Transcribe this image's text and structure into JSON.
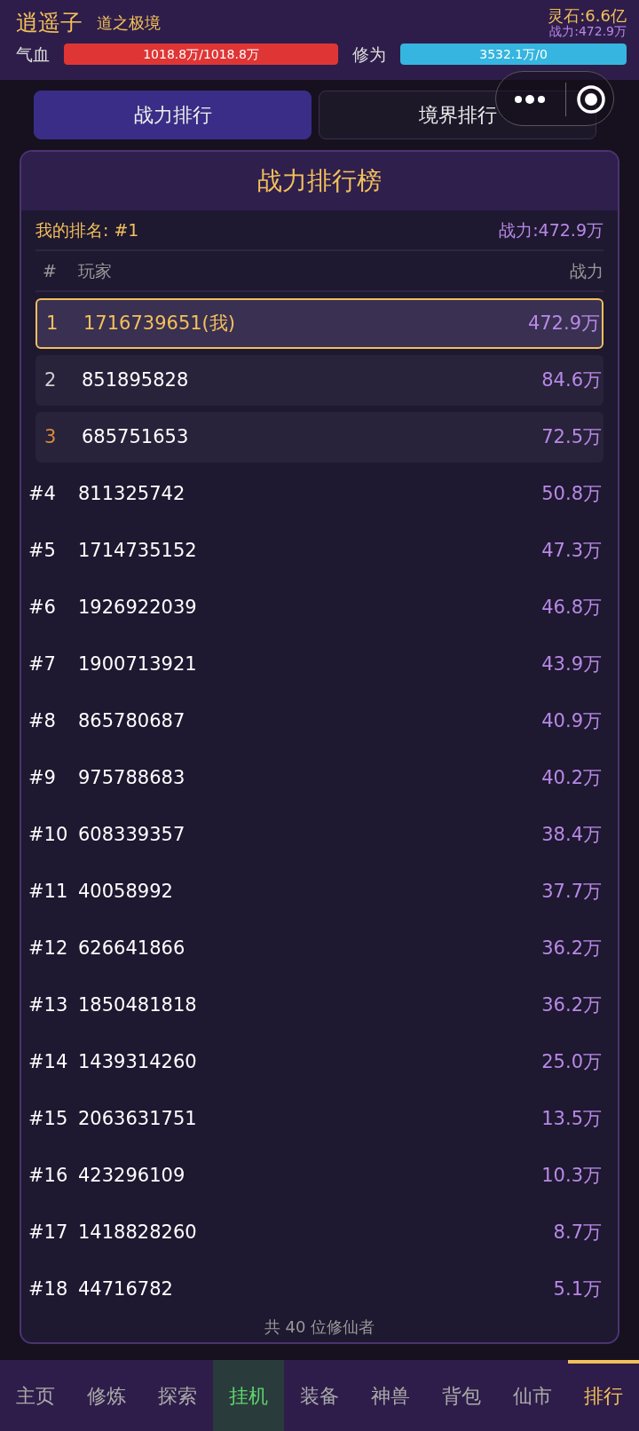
{
  "header": {
    "name": "逍遥子",
    "realm": "道之极境",
    "spirit_stones": "灵石:6.6亿",
    "power": "战力:472.9万",
    "bars": [
      {
        "label": "气血",
        "reading": "1018.8万/1018.8万",
        "level": 1.0,
        "kind": "hp"
      },
      {
        "label": "修为",
        "reading": "3532.1万/0",
        "level": 1.0,
        "kind": "xp"
      }
    ]
  },
  "tabs": [
    {
      "label": "战力排行",
      "selected": true
    },
    {
      "label": "境界排行",
      "selected": false
    }
  ],
  "ranking": {
    "title": "战力排行榜",
    "my_rank": "我的排名: #1",
    "my_power": "战力:472.9万",
    "columns": [
      "#",
      "玩家",
      "战力"
    ],
    "rows": [
      {
        "rank": "1",
        "player": "1716739651(我)",
        "power": "472.9万",
        "kind": "podium",
        "color": "#f3c05a",
        "selected": true
      },
      {
        "rank": "2",
        "player": "851895828",
        "power": "84.6万",
        "kind": "podium",
        "color": "#cfcfcf",
        "selected": false
      },
      {
        "rank": "3",
        "player": "685751653",
        "power": "72.5万",
        "kind": "podium",
        "color": "#d98a3d",
        "selected": false
      },
      {
        "rank": "#4",
        "player": "811325742",
        "power": "50.8万",
        "kind": "plain",
        "selected": false
      },
      {
        "rank": "#5",
        "player": "1714735152",
        "power": "47.3万",
        "kind": "plain",
        "selected": false
      },
      {
        "rank": "#6",
        "player": "1926922039",
        "power": "46.8万",
        "kind": "plain",
        "selected": false
      },
      {
        "rank": "#7",
        "player": "1900713921",
        "power": "43.9万",
        "kind": "plain",
        "selected": false
      },
      {
        "rank": "#8",
        "player": "865780687",
        "power": "40.9万",
        "kind": "plain",
        "selected": false
      },
      {
        "rank": "#9",
        "player": "975788683",
        "power": "40.2万",
        "kind": "plain",
        "selected": false
      },
      {
        "rank": "#10",
        "player": "608339357",
        "power": "38.4万",
        "kind": "plain",
        "selected": false
      },
      {
        "rank": "#11",
        "player": "40058992",
        "power": "37.7万",
        "kind": "plain",
        "selected": false
      },
      {
        "rank": "#12",
        "player": "626641866",
        "power": "36.2万",
        "kind": "plain",
        "selected": false
      },
      {
        "rank": "#13",
        "player": "1850481818",
        "power": "36.2万",
        "kind": "plain",
        "selected": false
      },
      {
        "rank": "#14",
        "player": "1439314260",
        "power": "25.0万",
        "kind": "plain",
        "selected": false
      },
      {
        "rank": "#15",
        "player": "2063631751",
        "power": "13.5万",
        "kind": "plain",
        "selected": false
      },
      {
        "rank": "#16",
        "player": "423296109",
        "power": "10.3万",
        "kind": "plain",
        "selected": false
      },
      {
        "rank": "#17",
        "player": "1418828260",
        "power": "8.7万",
        "kind": "plain",
        "selected": false
      },
      {
        "rank": "#18",
        "player": "44716782",
        "power": "5.1万",
        "kind": "plain",
        "selected": false
      }
    ],
    "footer": "共 40 位修仙者"
  },
  "bottom_nav": [
    {
      "label": "主页",
      "selected": false,
      "highlighted": false
    },
    {
      "label": "修炼",
      "selected": false,
      "highlighted": false
    },
    {
      "label": "探索",
      "selected": false,
      "highlighted": false
    },
    {
      "label": "挂机",
      "selected": false,
      "highlighted": true
    },
    {
      "label": "装备",
      "selected": false,
      "highlighted": false
    },
    {
      "label": "神兽",
      "selected": false,
      "highlighted": false
    },
    {
      "label": "背包",
      "selected": false,
      "highlighted": false
    },
    {
      "label": "仙市",
      "selected": false,
      "highlighted": false
    },
    {
      "label": "排行",
      "selected": true,
      "highlighted": false
    }
  ]
}
